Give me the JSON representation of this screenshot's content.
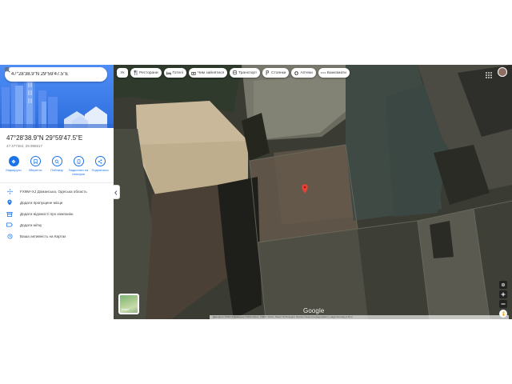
{
  "search": {
    "value": "47°28'38.9\"N 29°59'47.5\"E",
    "search_icon": "search-icon",
    "close_icon": "close-icon"
  },
  "place": {
    "title": "47°28'38.9\"N 29°59'47.5\"E",
    "coords": "47.477464, 29.996517"
  },
  "actions": [
    {
      "label": "Маршрути",
      "icon": "directions-icon"
    },
    {
      "label": "Зберегти",
      "icon": "bookmark-icon"
    },
    {
      "label": "Поблизу",
      "icon": "nearby-icon"
    },
    {
      "label": "Надіслати на телефон",
      "icon": "send-to-phone-icon"
    },
    {
      "label": "Поділитися",
      "icon": "share-icon"
    }
  ],
  "info": [
    {
      "text": "FX9M+XJ Доманська, Одеська область",
      "icon": "plus-code-icon"
    },
    {
      "text": "Додати пропущене місце",
      "icon": "add-place-icon"
    },
    {
      "text": "Додати відомості про компанію",
      "icon": "add-business-icon"
    },
    {
      "text": "Додати мітку",
      "icon": "label-icon"
    },
    {
      "text": "Ваша активність на Картах",
      "icon": "history-icon"
    }
  ],
  "chips": [
    {
      "label": "Ресторани",
      "icon": "restaurant-icon"
    },
    {
      "label": "Готелі",
      "icon": "hotel-icon"
    },
    {
      "label": "Чим зайнятися",
      "icon": "attractions-icon"
    },
    {
      "label": "Транспорт",
      "icon": "transit-icon"
    },
    {
      "label": "Стоянки",
      "icon": "parking-icon"
    },
    {
      "label": "Аптеки",
      "icon": "pharmacy-icon"
    },
    {
      "label": "Банкомати",
      "icon": "more-icon"
    }
  ],
  "chip_first": "Ук",
  "map": {
    "layers_label": "Шари",
    "google_logo": "Google",
    "attribution": "Дані карти ©2023  Зображення ©2023 Airbus, CNES / Airbus, Maxar Technologies   Україна   Умови   Конфіденційність   Надіслати відгук   20 м"
  },
  "colors": {
    "accent": "#1a73e8",
    "pin": "#ea4335",
    "hero_sky": "#4f8ef5"
  }
}
